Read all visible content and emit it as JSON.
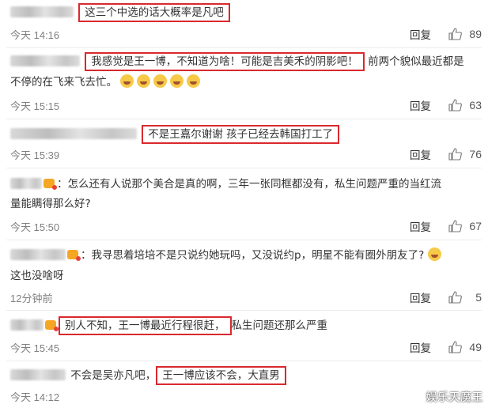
{
  "comments": [
    {
      "text": "这三个中选的话大概率是凡吧",
      "time": "今天 14:16",
      "reply": "回复",
      "likes": "89"
    },
    {
      "text": "我感觉是王一博，不知道为啥！可能是吉美禾的阴影吧！",
      "text_after": "前两个貌似最近都是",
      "line2": "不停的在飞来飞去忙。",
      "time": "今天 15:15",
      "reply": "回复",
      "likes": "63"
    },
    {
      "text": "不是王嘉尔谢谢 孩子已经去韩国打工了",
      "time": "今天 15:39",
      "reply": "回复",
      "likes": "76"
    },
    {
      "text": "：怎么还有人说那个美合是真的啊，三年一张同框都没有，私生问题严重的当红流",
      "line2": "量能瞒得那么好?",
      "time": "今天 15:50",
      "reply": "回复",
      "likes": "67"
    },
    {
      "text": "：我寻思着培培不是只说约她玩吗，又没说约p，明星不能有圈外朋友了?",
      "line2": "这也没啥呀",
      "time": "12分钟前",
      "reply": "回复",
      "likes": "5"
    },
    {
      "text": "别人不知，王一博最近行程很赶，",
      "text_after": "私生问题还那么严重",
      "time": "今天 15:45",
      "reply": "回复",
      "likes": "49"
    },
    {
      "text_before": "不会是吴亦凡吧，",
      "text": "王一博应该不会，大直男",
      "time": "今天 14:12",
      "reply": "回复",
      "likes": ""
    }
  ],
  "watermark": "娱乐天魔王",
  "colors": {
    "highlight": "#d9292d",
    "time": "#808080",
    "text": "#333333"
  }
}
